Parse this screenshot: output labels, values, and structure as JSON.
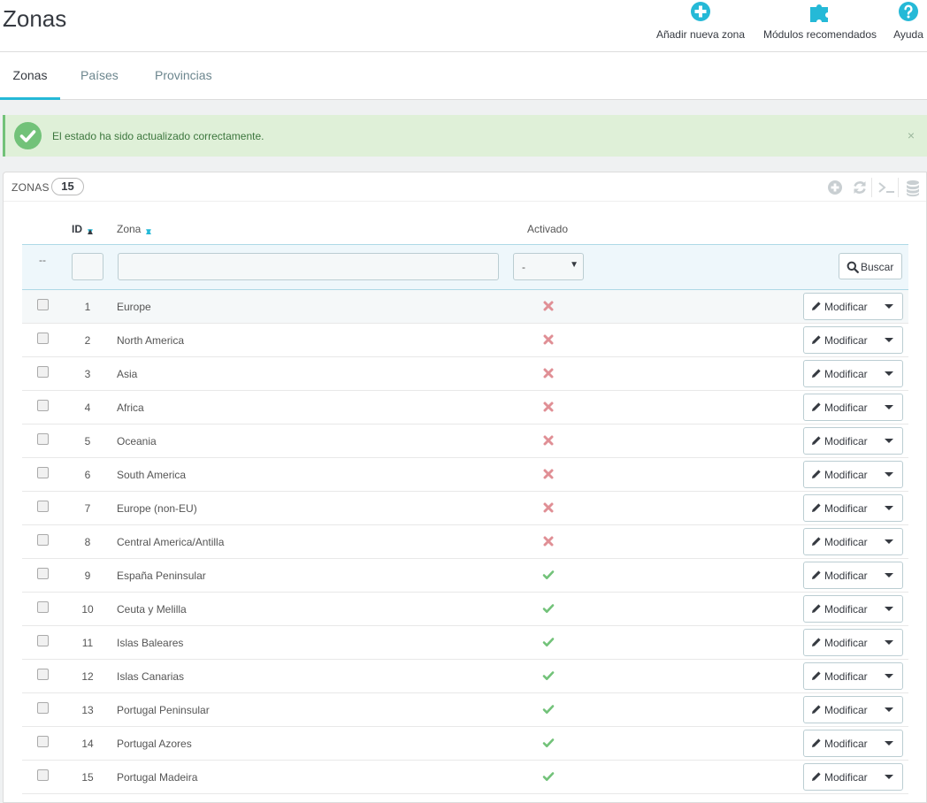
{
  "header": {
    "title": "Zonas",
    "actions": [
      {
        "label": "Añadir nueva zona",
        "icon": "plus-circle-icon"
      },
      {
        "label": "Módulos recomendados",
        "icon": "puzzle-icon"
      },
      {
        "label": "Ayuda",
        "icon": "help-circle-icon"
      }
    ]
  },
  "tabs": [
    {
      "label": "Zonas",
      "active": true
    },
    {
      "label": "Países",
      "active": false
    },
    {
      "label": "Provincias",
      "active": false
    }
  ],
  "alert": {
    "message": "El estado ha sido actualizado correctamente.",
    "close": "×"
  },
  "panel": {
    "title": "ZONAS",
    "count": "15",
    "tools": [
      "add-icon",
      "refresh-icon",
      "sql-terminal-icon",
      "database-export-icon"
    ]
  },
  "table": {
    "columns": {
      "id": "ID",
      "zone": "Zona",
      "active": "Activado"
    },
    "filters": {
      "placeholder_dash": "--",
      "select_value": "-",
      "search_label": "Buscar"
    },
    "edit_label": "Modificar",
    "rows": [
      {
        "id": "1",
        "name": "Europe",
        "active": false
      },
      {
        "id": "2",
        "name": "North America",
        "active": false
      },
      {
        "id": "3",
        "name": "Asia",
        "active": false
      },
      {
        "id": "4",
        "name": "Africa",
        "active": false
      },
      {
        "id": "5",
        "name": "Oceania",
        "active": false
      },
      {
        "id": "6",
        "name": "South America",
        "active": false
      },
      {
        "id": "7",
        "name": "Europe (non-EU)",
        "active": false
      },
      {
        "id": "8",
        "name": "Central America/Antilla",
        "active": false
      },
      {
        "id": "9",
        "name": "España Peninsular",
        "active": true
      },
      {
        "id": "10",
        "name": "Ceuta y Melilla",
        "active": true
      },
      {
        "id": "11",
        "name": "Islas Baleares",
        "active": true
      },
      {
        "id": "12",
        "name": "Islas Canarias",
        "active": true
      },
      {
        "id": "13",
        "name": "Portugal Peninsular",
        "active": true
      },
      {
        "id": "14",
        "name": "Portugal Azores",
        "active": true
      },
      {
        "id": "15",
        "name": "Portugal Madeira",
        "active": true
      }
    ]
  },
  "colors": {
    "accent": "#25b9d7",
    "success": "#72c279",
    "danger": "#e08f95",
    "text": "#363a41"
  }
}
